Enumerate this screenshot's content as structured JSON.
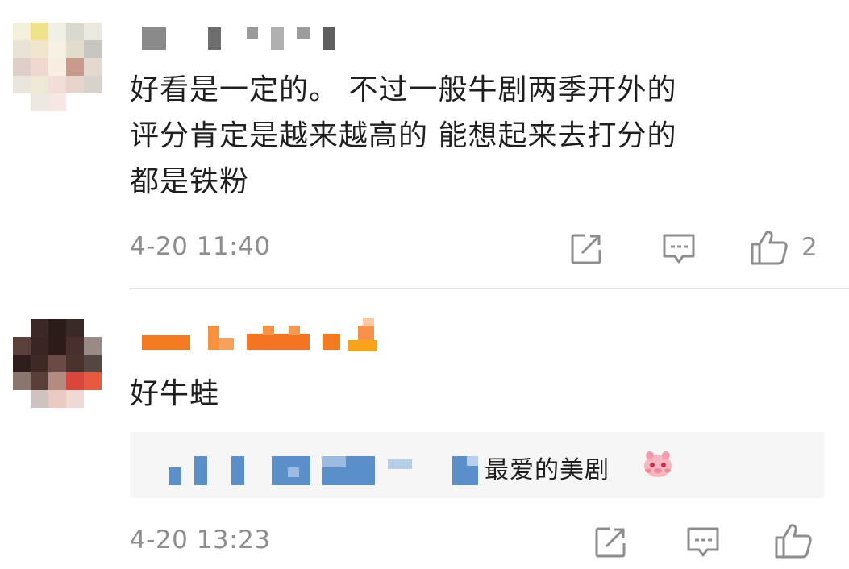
{
  "comments": [
    {
      "avatar_alt": "avatar",
      "username_masked": true,
      "text_lines": [
        "好看是一定的。 不过一般牛剧两季开外的",
        "评分肯定是越来越高的 能想起来去打分的",
        "都是铁粉"
      ],
      "timestamp": "4-20 11:40",
      "like_count": "2"
    },
    {
      "avatar_alt": "avatar",
      "username_masked": true,
      "text_lines": [
        "好牛蛙"
      ],
      "reply": {
        "author_masked": true,
        "text": "最爱的美剧",
        "emoji": "blushing-pig-emoji"
      },
      "timestamp": "4-20 13:23",
      "like_count": ""
    }
  ],
  "colors": {
    "meta": "#8e8e8e",
    "reply_bg": "#f6f6f6",
    "reply_author": "#5b8fc9",
    "username_orange": "#f47a1f",
    "divider": "#e6e6e6"
  },
  "icons": [
    "share-icon",
    "comment-icon",
    "like-icon"
  ]
}
